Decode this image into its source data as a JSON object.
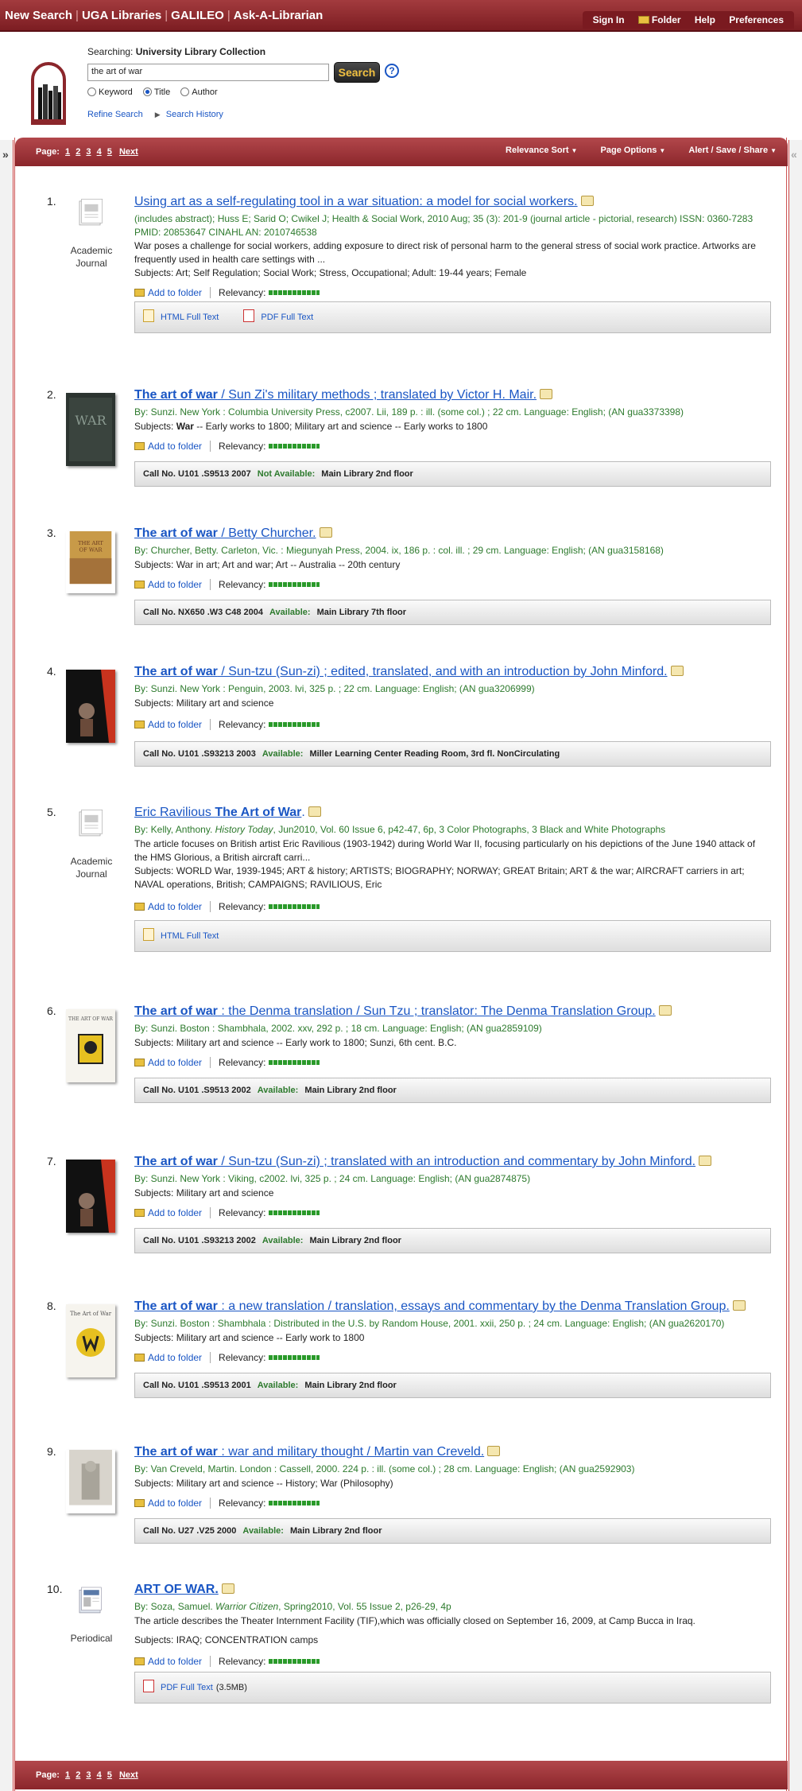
{
  "topnav": {
    "items": [
      "New Search",
      "UGA Libraries",
      "GALILEO",
      "Ask-A-Librarian"
    ]
  },
  "topright": {
    "sign_in": "Sign In",
    "folder": "Folder",
    "help": "Help",
    "preferences": "Preferences"
  },
  "search": {
    "searching_label": "Searching:",
    "collection": "University Library Collection",
    "query": "the art of war",
    "button": "Search",
    "help": "?",
    "options": [
      "Keyword",
      "Title",
      "Author"
    ],
    "selected": "Title",
    "refine": "Refine Search",
    "history": "Search History"
  },
  "pager": {
    "label": "Page:",
    "pages": [
      "1",
      "2",
      "3",
      "4",
      "5"
    ],
    "next": "Next",
    "sort": "Relevance Sort",
    "page_options": "Page Options",
    "alert": "Alert / Save / Share"
  },
  "common": {
    "add_to_folder": "Add to folder",
    "relevancy": "Relevancy:"
  },
  "results": [
    {
      "num": "1.",
      "title": "Using art as a self-regulating tool in a war situation: a model for social workers.",
      "meta": "(includes abstract); Huss E; Sarid O; Cwikel J; Health & Social Work, 2010 Aug; 35 (3): 201-9 (journal article - pictorial, research) ISSN: 0360-7283 PMID: 20853647 CINAHL AN: 2010746538",
      "abstract": "War poses a challenge for social workers, adding exposure to direct risk of personal harm to the general stress of social work practice. Artworks are frequently used in health care settings with ...",
      "subjects": "Subjects: Art; Self Regulation; Social Work; Stress, Occupational; Adult: 19-44 years; Female",
      "type_label": "Academic Journal",
      "html_full": "HTML Full Text",
      "pdf_full": "PDF Full Text"
    },
    {
      "num": "2.",
      "title_bold": "The art of war",
      "title_rest": " / Sun Zi's military methods ; translated by Victor H. Mair.",
      "meta": "By: Sunzi. New York : Columbia University Press, c2007. Lii, 189 p. : ill. (some col.) ; 22 cm. Language: English; (AN gua3373398)",
      "subjects_pre": "Subjects: ",
      "subjects_bold": "War",
      "subjects_post": " -- Early works to 1800; Military art and science -- Early works to 1800",
      "call": "Call No. U101 .S9513 2007",
      "status": "Not Available:",
      "location": "Main Library 2nd floor"
    },
    {
      "num": "3.",
      "title_bold": "The art of war",
      "title_rest": " / Betty Churcher.",
      "meta": "By: Churcher, Betty. Carleton, Vic. : Miegunyah Press, 2004. ix, 186 p. : col. ill. ; 29 cm. Language: English; (AN gua3158168)",
      "subjects": "Subjects: War in art; Art and war; Art -- Australia -- 20th century",
      "call": "Call No. NX650 .W3 C48 2004",
      "status": "Available:",
      "location": "Main Library 7th floor"
    },
    {
      "num": "4.",
      "title_bold": "The art of war",
      "title_rest": " / Sun-tzu (Sun-zi) ; edited, translated, and with an introduction by John Minford.",
      "meta": "By: Sunzi. New York : Penguin, 2003. lvi, 325 p. ; 22 cm. Language: English; (AN gua3206999)",
      "subjects": "Subjects: Military art and science",
      "call": "Call No. U101 .S93213 2003",
      "status": "Available:",
      "location": "Miller Learning Center Reading Room, 3rd fl. NonCirculating"
    },
    {
      "num": "5.",
      "title_pre": "Eric Ravilious ",
      "title_bold": "The Art of War",
      "title_rest": ".",
      "meta_pre": "By: Kelly, Anthony. ",
      "meta_italic": "History Today",
      "meta_post": ", Jun2010, Vol. 60 Issue 6, p42-47, 6p, 3 Color Photographs, 3 Black and White Photographs",
      "abstract": "The article focuses on British artist Eric Ravilious (1903-1942) during World War II, focusing particularly on his depictions of the June 1940 attack of the HMS Glorious, a British aircraft carri...",
      "subjects": "Subjects: WORLD War, 1939-1945; ART & history; ARTISTS; BIOGRAPHY; NORWAY; GREAT Britain; ART & the war; AIRCRAFT carriers in art; NAVAL operations, British; CAMPAIGNS; RAVILIOUS, Eric",
      "type_label": "Academic Journal",
      "html_full": "HTML Full Text"
    },
    {
      "num": "6.",
      "title_bold": "The art of war",
      "title_rest": " : the Denma translation / Sun Tzu ; translator: The Denma Translation Group.",
      "meta": "By: Sunzi. Boston : Shambhala, 2002. xxv, 292 p. ; 18 cm. Language: English; (AN gua2859109)",
      "subjects": "Subjects: Military art and science -- Early work to 1800; Sunzi, 6th cent. B.C.",
      "call": "Call No. U101 .S9513 2002",
      "status": "Available:",
      "location": "Main Library 2nd floor",
      "thumb_text": "THE ART OF WAR"
    },
    {
      "num": "7.",
      "title_bold": "The art of war",
      "title_rest": " / Sun-tzu (Sun-zi) ; translated with an introduction and commentary by John Minford.",
      "meta": "By: Sunzi. New York : Viking, c2002. lvi, 325 p. ; 24 cm. Language: English; (AN gua2874875)",
      "subjects": "Subjects: Military art and science",
      "call": "Call No. U101 .S93213 2002",
      "status": "Available:",
      "location": "Main Library 2nd floor"
    },
    {
      "num": "8.",
      "title_bold": "The art of war",
      "title_rest": " : a new translation / translation, essays and commentary by the Denma Translation Group.",
      "meta": "By: Sunzi. Boston : Shambhala : Distributed in the U.S. by Random House, 2001. xxii, 250 p. ; 24 cm. Language: English; (AN gua2620170)",
      "subjects": "Subjects: Military art and science -- Early work to 1800",
      "call": "Call No. U101 .S9513 2001",
      "status": "Available:",
      "location": "Main Library 2nd floor",
      "thumb_text": "The Art of War"
    },
    {
      "num": "9.",
      "title_bold": "The art of war",
      "title_rest": " : war and military thought / Martin van Creveld.",
      "meta": "By: Van Creveld, Martin. London : Cassell, 2000. 224 p. : ill. (some col.) ; 28 cm. Language: English; (AN gua2592903)",
      "subjects": "Subjects: Military art and science -- History; War (Philosophy)",
      "call": "Call No. U27 .V25 2000",
      "status": "Available:",
      "location": "Main Library 2nd floor"
    },
    {
      "num": "10.",
      "title": "ART OF WAR.",
      "meta_pre": "By: Soza, Samuel. ",
      "meta_italic": "Warrior Citizen",
      "meta_post": ", Spring2010, Vol. 55 Issue 2, p26-29, 4p",
      "abstract": "The article describes the Theater Internment Facility (TIF),which was officially closed on September 16, 2009, at Camp Bucca in Iraq.",
      "subjects": "Subjects: IRAQ; CONCENTRATION camps",
      "type_label": "Periodical",
      "pdf_full": "PDF Full Text",
      "pdf_size": "(3.5MB)"
    }
  ],
  "colors": {
    "bar": "#8b262b",
    "link": "#1a56c4",
    "meta_green": "#2d7a2d"
  }
}
